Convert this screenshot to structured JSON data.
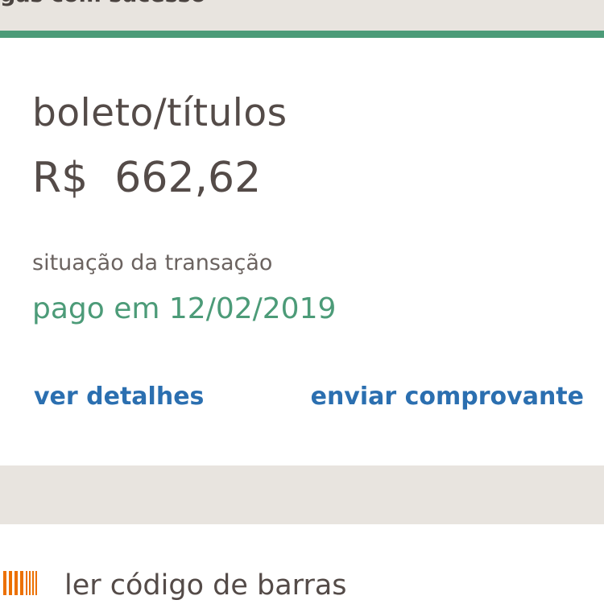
{
  "banner": {
    "text": "gas com sucesso"
  },
  "payment": {
    "title": "boleto/títulos",
    "amount": "R$  662,62",
    "status_label": "situação da transação",
    "status_value": "pago em 12/02/2019"
  },
  "actions": {
    "details_label": "ver detalhes",
    "send_receipt_label": "enviar comprovante"
  },
  "scan": {
    "label": "ler código de barras",
    "icon": "barcode-icon"
  },
  "colors": {
    "accent_green": "#4c9b78",
    "link_blue": "#2b6fb0",
    "icon_orange": "#ec7000",
    "background": "#e8e4df"
  }
}
